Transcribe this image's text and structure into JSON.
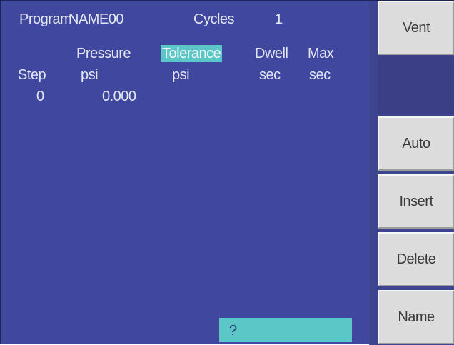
{
  "header": {
    "program_label": "Program",
    "program_name": "NAME00",
    "cycles_label": "Cycles",
    "cycles_value": "1"
  },
  "columns": {
    "pressure": "Pressure",
    "tolerance": "Tolerance",
    "dwell": "Dwell",
    "max": "Max",
    "step": "Step",
    "pressure_unit": "psi",
    "tolerance_unit": "psi",
    "dwell_unit": "sec",
    "max_unit": "sec"
  },
  "rows": [
    {
      "step": "0",
      "pressure": "0.000"
    }
  ],
  "prompt": {
    "text": "?"
  },
  "softkeys": {
    "vent": "Vent",
    "auto": "Auto",
    "insert": "Insert",
    "delete": "Delete",
    "name": "Name"
  },
  "colors": {
    "background": "#3f489e",
    "highlight": "#5bc7c6",
    "softkey": "#dcdcdc",
    "text": "#e4e6f4"
  }
}
